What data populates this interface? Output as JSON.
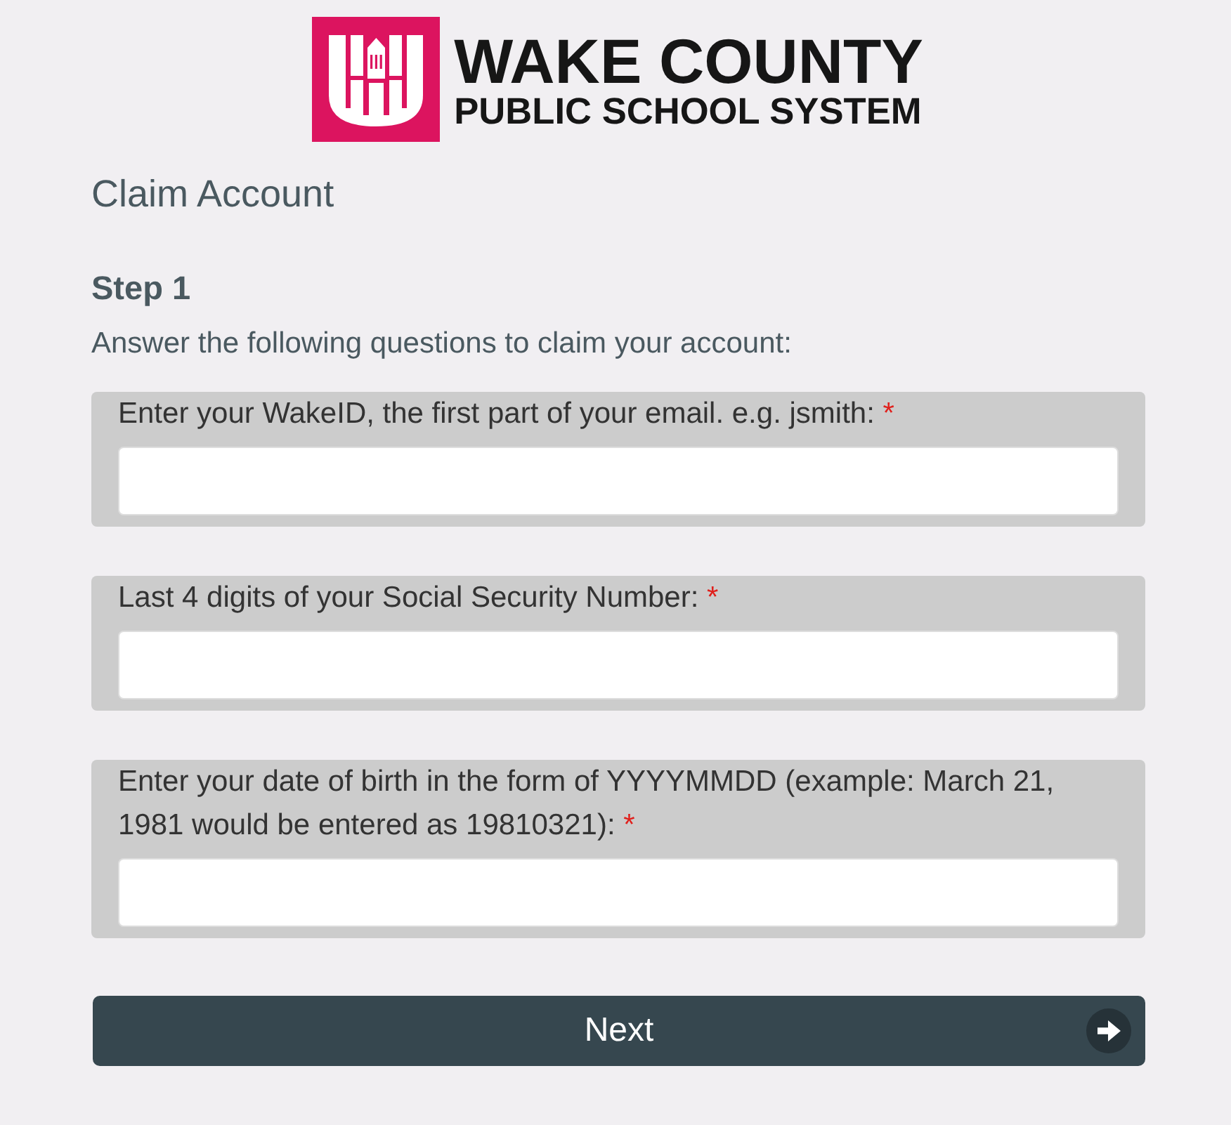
{
  "logo": {
    "line_1": "WAKE COUNTY",
    "line_2": "PUBLIC SCHOOL SYSTEM"
  },
  "title": "Claim Account",
  "step": {
    "heading": "Step 1",
    "instructions": "Answer the following questions to claim your account:"
  },
  "fields": [
    {
      "label": "Enter your WakeID, the first part of your email. e.g. jsmith:",
      "required_mark": "*"
    },
    {
      "label": "Last 4 digits of your Social Security Number:",
      "required_mark": "*"
    },
    {
      "label": "Enter your date of birth in the form of YYYYMMDD (example: March 21, 1981 would be entered as 19810321):",
      "required_mark": "*"
    }
  ],
  "next_button": {
    "label": "Next"
  }
}
